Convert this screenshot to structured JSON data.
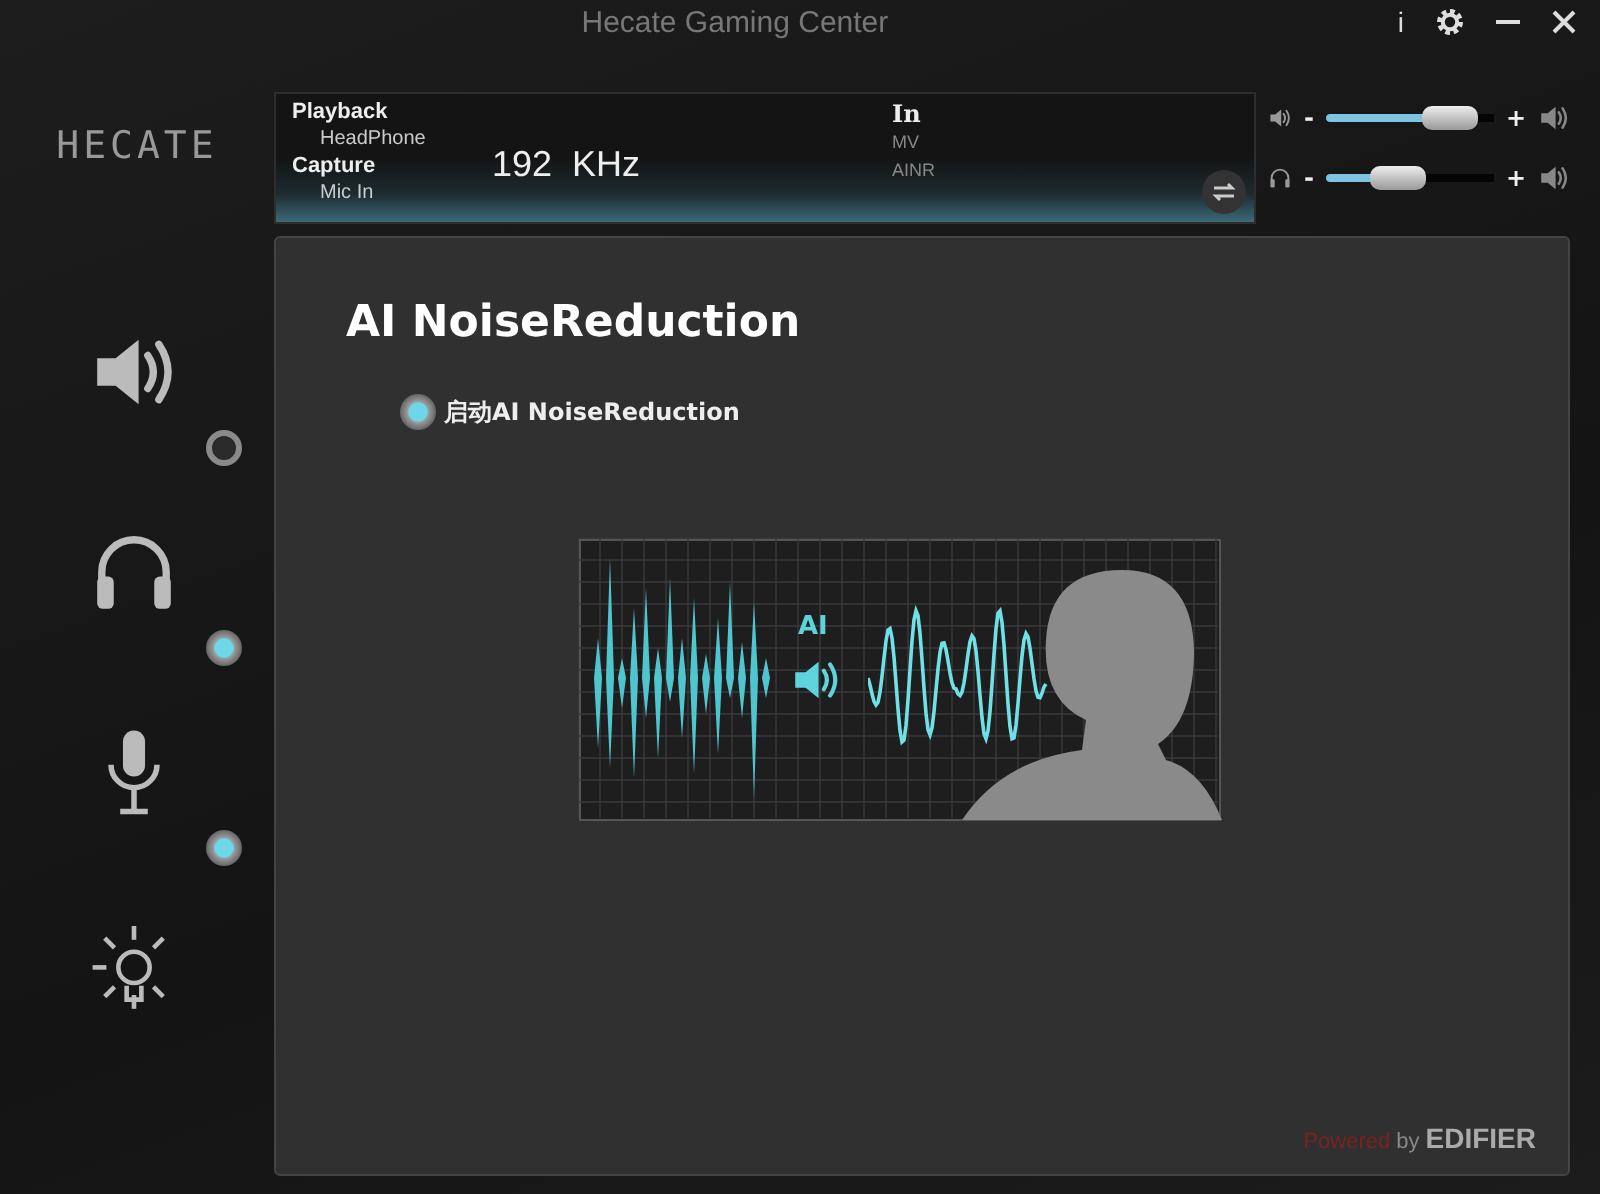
{
  "window": {
    "title": "Hecate Gaming Center",
    "buttons": [
      {
        "kind": "info",
        "label": "i"
      },
      {
        "kind": "settings"
      },
      {
        "kind": "minimize"
      },
      {
        "kind": "close"
      }
    ]
  },
  "logo": {
    "text": "HECATE"
  },
  "info_panel": {
    "left": [
      {
        "heading": "Playback",
        "value": "HeadPhone"
      },
      {
        "heading": "Capture",
        "value": "Mic In"
      }
    ],
    "rate": "192  KHz",
    "right": {
      "heading": "In",
      "lines": [
        "MV",
        "AINR"
      ]
    }
  },
  "volume": [
    {
      "kind": "speaker",
      "minus": "-",
      "plus": "+",
      "level": 0.85
    },
    {
      "kind": "headphone",
      "minus": "-",
      "plus": "+",
      "level": 0.4
    }
  ],
  "sidebar": {
    "items": [
      {
        "kind": "speaker",
        "checked": false
      },
      {
        "kind": "headphone",
        "checked": true
      },
      {
        "kind": "mic",
        "checked": true
      },
      {
        "kind": "light"
      }
    ]
  },
  "content": {
    "title": "AI NoiseReduction",
    "option": {
      "label": "启动AI NoiseReduction",
      "checked": true
    },
    "illustration": {
      "ai_label": "AI"
    }
  },
  "footer": {
    "powered": "Powered",
    "by": "by",
    "brand": "EDIFIER"
  }
}
